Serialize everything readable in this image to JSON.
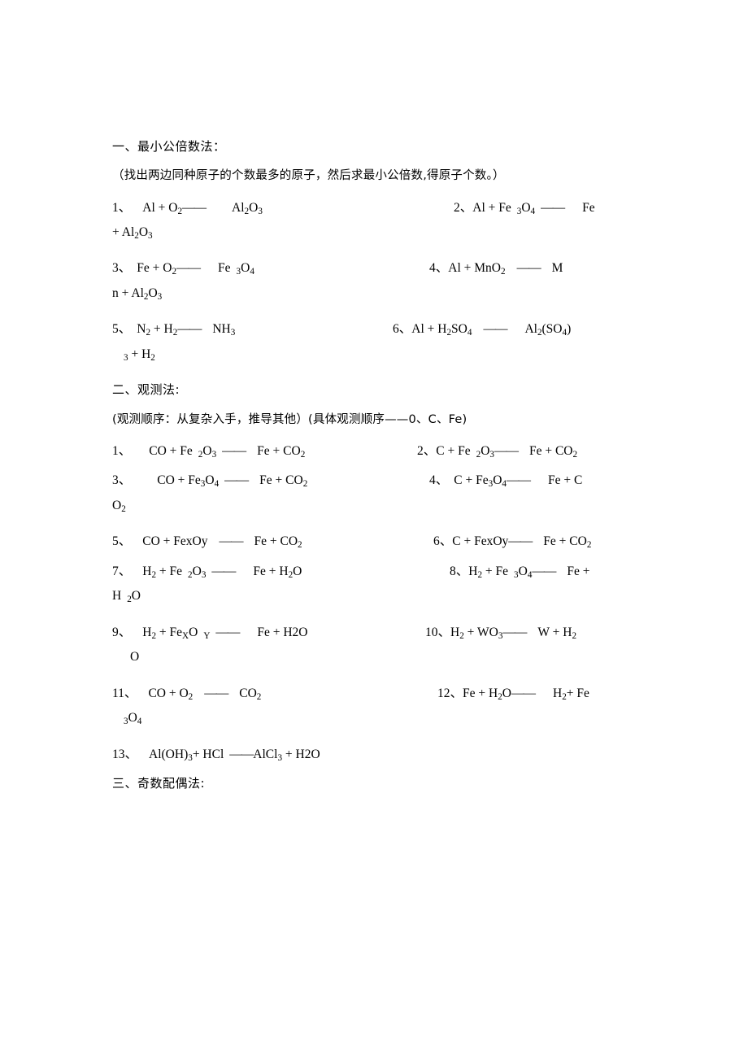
{
  "document": {
    "sections": [
      {
        "id": "section-1",
        "heading": "一、最小公倍数法：",
        "note": "（找出两边同种原子的个数最多的原子，然后求最小公倍数,得原子个数。）"
      },
      {
        "id": "section-2",
        "heading": "二、观测法:",
        "note": "(观测顺序：从复杂入手，推导其他）(具体观测顺序——0、C、Fe)"
      },
      {
        "id": "section-3",
        "heading": "三、奇数配偶法:"
      }
    ],
    "group1": {
      "row1": {
        "left": {
          "num": "1、",
          "reactants": "Al  +   O",
          "r_sub": "2",
          "arrow": "——",
          "products": "Al",
          "p_sub1": "2",
          "p_mid": "O",
          "p_sub2": "3"
        },
        "right": {
          "num": "2、",
          "text_a": "Al  +  Fe",
          "sub_a": "3",
          "text_b": "O",
          "sub_b": "4",
          "arrow": "——",
          "text_c": "Fe",
          "wrap_a": "+   Al",
          "wrap_sub1": "2",
          "wrap_b": "O",
          "wrap_sub2": "3"
        }
      },
      "row2": {
        "left": {
          "num": "3、",
          "text_a": "Fe  +  O",
          "sub_a": "2",
          "arrow": "——",
          "text_b": "Fe",
          "sub_b": "3",
          "text_c": "O",
          "sub_c": "4"
        },
        "right": {
          "num": "4、",
          "text_a": "Al   +   MnO",
          "sub_a": "2",
          "arrow": "——",
          "text_b": "M",
          "wrap_a": "n +   Al",
          "wrap_sub1": "2",
          "wrap_b": "O",
          "wrap_sub2": "3"
        }
      },
      "row3": {
        "left": {
          "num": "5、",
          "text_a": "N",
          "sub_a": "2",
          "text_b": "  +  H",
          "sub_b": "2",
          "arrow": "——",
          "text_c": "NH",
          "sub_c": "3"
        },
        "right": {
          "num": "6、",
          "text_a": "Al +   H",
          "sub_a": "2",
          "text_b": "SO",
          "sub_b": "4",
          "arrow": "——",
          "text_c": "Al",
          "sub_c": "2",
          "text_d": "(SO",
          "sub_d": "4",
          "text_e": ")",
          "wrap_sub": "3",
          "wrap_a": " +  H",
          "wrap_sub2": "2"
        }
      }
    },
    "group2": {
      "row1": {
        "left": {
          "num": "1、",
          "text_a": "CO + Fe",
          "sub_a": "2",
          "text_b": "O",
          "sub_b": "3",
          "arrow": "——",
          "text_c": "Fe  +  CO",
          "sub_c": "2"
        },
        "right": {
          "num": "2、",
          "text_a": "C + Fe",
          "sub_a": "2",
          "text_b": "O",
          "sub_b": "3",
          "arrow": "——",
          "text_c": "Fe  +  CO",
          "sub_c": "2"
        }
      },
      "row2": {
        "left": {
          "num": "3、",
          "text_a": "CO +   Fe",
          "sub_a": "3",
          "text_b": "O",
          "sub_b": "4",
          "arrow": "——",
          "text_c": "Fe +  CO",
          "sub_c": "2"
        },
        "right": {
          "num": "4、",
          "text_a": "C  + Fe",
          "sub_a": "3",
          "text_b": "O",
          "sub_b": "4",
          "arrow": "——",
          "text_c": "Fe +  C",
          "wrap_a": "O",
          "wrap_sub": "2"
        }
      },
      "row3": {
        "left": {
          "num": "5、",
          "text_a": "CO  +  FexOy",
          "arrow": "——",
          "text_b": "Fe + CO",
          "sub_b": "2"
        },
        "right": {
          "num": "6、",
          "text_a": "C + FexOy",
          "arrow": "——",
          "text_b": "Fe  +  CO",
          "sub_b": "2"
        }
      },
      "row4": {
        "left": {
          "num": "7、",
          "text_a": "H",
          "sub_a": "2",
          "text_b": " +   Fe",
          "sub_b": "2",
          "text_c": "O",
          "sub_c": "3",
          "arrow": "——",
          "text_d": "Fe +   H",
          "sub_d": "2",
          "text_e": "O"
        },
        "right": {
          "num": "8、",
          "text_a": "H",
          "sub_a": "2",
          "text_b": " + Fe",
          "sub_b": "3",
          "text_c": "O",
          "sub_c": "4",
          "arrow": "——",
          "text_d": "Fe +",
          "wrap_a": "H",
          "wrap_sub": "2",
          "wrap_b": "O"
        }
      },
      "row5": {
        "left": {
          "num": "9、",
          "text_a": "H",
          "sub_a": "2",
          "text_b": " +  Fe",
          "sub_b": "X",
          "text_c": "O",
          "sub_c": "Y",
          "arrow": "——",
          "text_d": "Fe  +  H2O"
        },
        "right": {
          "num": "10、",
          "text_a": "H",
          "sub_a": "2",
          "text_b": " + WO",
          "sub_b": "3",
          "arrow": "——",
          "text_c": "W +  H",
          "sub_c": "2",
          "wrap_a": "O"
        }
      },
      "row6": {
        "left": {
          "num": "11、",
          "text_a": "CO   +  O",
          "sub_a": "2",
          "arrow": "——",
          "text_b": "CO",
          "sub_b": "2"
        },
        "right": {
          "num": "12、",
          "text_a": "Fe +  H",
          "sub_a": "2",
          "text_b": "O",
          "arrow": "——",
          "text_c": "H",
          "sub_c": "2",
          "text_d": "+    Fe",
          "wrap_sub": "3",
          "wrap_a": "O",
          "wrap_sub2": "4"
        }
      },
      "row7": {
        "left": {
          "num": "13、",
          "text_a": "Al(OH)",
          "sub_a": "3",
          "text_b": "+    HCl",
          "arrow": "——",
          "text_c": "AlCl",
          "sub_c": "3",
          "text_d": "  +   H2O"
        }
      }
    }
  }
}
